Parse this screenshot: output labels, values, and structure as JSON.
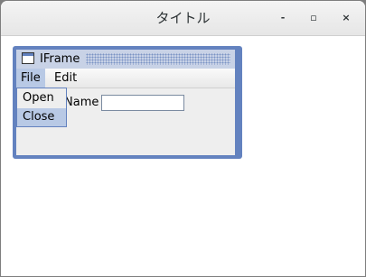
{
  "window": {
    "title": "タイトル",
    "minimize_glyph": "-",
    "maximize_glyph": "▫",
    "close_glyph": "×"
  },
  "internal_frame": {
    "title": "IFrame",
    "menubar": {
      "items": [
        "File",
        "Edit"
      ],
      "open_menu": "File"
    },
    "file_menu": {
      "items": [
        "Open",
        "Close"
      ],
      "highlighted": "Close"
    },
    "form": {
      "name_label": "Name",
      "name_value": ""
    }
  },
  "colors": {
    "frame_border": "#6382bf",
    "title_tint": "#c8d2e6",
    "selection": "#b8c9e5"
  }
}
